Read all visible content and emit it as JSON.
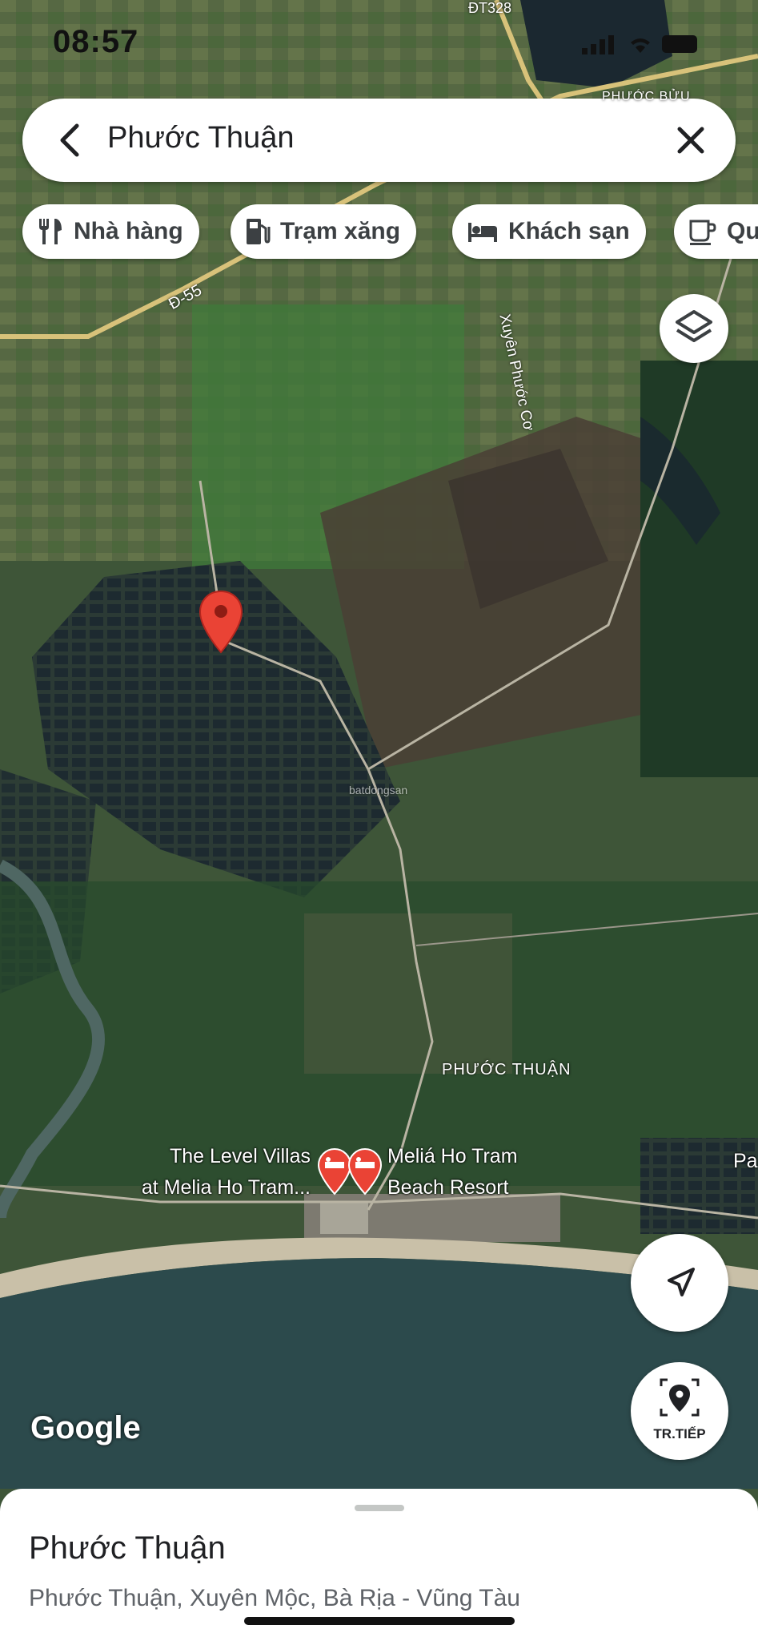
{
  "status_bar": {
    "time": "08:57"
  },
  "search": {
    "query": "Phước Thuận"
  },
  "chips": [
    {
      "label": "Nhà hàng",
      "icon": "restaurant-icon"
    },
    {
      "label": "Trạm xăng",
      "icon": "gas-station-icon"
    },
    {
      "label": "Khách sạn",
      "icon": "hotel-icon"
    },
    {
      "label": "Qu",
      "icon": "cafe-icon"
    }
  ],
  "map": {
    "road_labels": {
      "top": "ĐT328",
      "d55": "Đ-55",
      "xuyen_phuoc_co": "Xuyên Phước Cơ"
    },
    "area_labels": {
      "phuoc_thuan": "PHƯỚC THUẬN",
      "phuoc_buu": "PHƯỚC BỬU"
    },
    "pois": [
      {
        "label_line1": "The Level Villas",
        "label_line2": "at Melia Ho Tram..."
      },
      {
        "label_line1": "Meliá Ho Tram",
        "label_line2": "Beach Resort"
      }
    ],
    "edge_label": "Pa",
    "watermark": "batdongsan",
    "logo": "Google",
    "colors": {
      "pin": "#ea4335",
      "sea": "#2c4a4c",
      "land": "#3d5a38"
    }
  },
  "controls": {
    "navigate_label": "TR.TIẾP"
  },
  "place_sheet": {
    "title": "Phước Thuận",
    "address": "Phước Thuận, Xuyên Mộc, Bà Rịa - Vũng Tàu"
  }
}
